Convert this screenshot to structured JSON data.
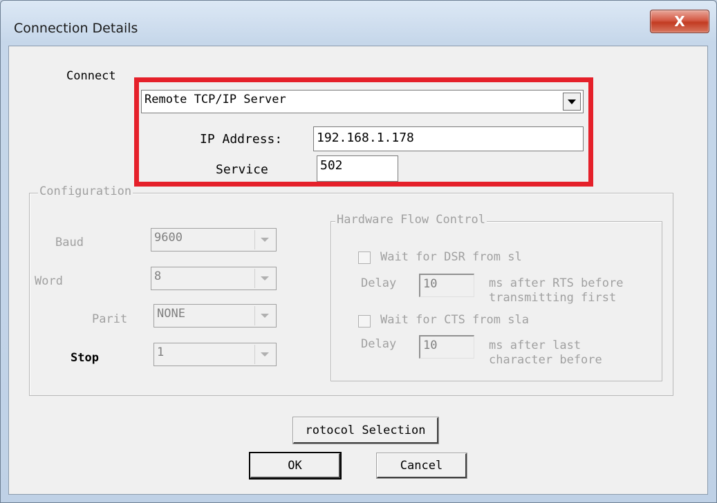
{
  "window": {
    "title": "Connection Details",
    "close_glyph": "X"
  },
  "connect": {
    "label": "Connect",
    "selected": "Remote TCP/IP Server",
    "ip_label": "IP Address:",
    "ip_value": "192.168.1.178",
    "service_label": "Service",
    "service_value": "502"
  },
  "configuration": {
    "title": "Configuration",
    "baud": {
      "label": "Baud",
      "value": "9600"
    },
    "word": {
      "label": "Word",
      "value": "8"
    },
    "parity": {
      "label": "Parit",
      "value": "NONE"
    },
    "stop": {
      "label": "Stop",
      "value": "1"
    }
  },
  "flow": {
    "title": "Hardware Flow Control",
    "dsr": {
      "check_label": "Wait for DSR from sl",
      "delay_label": "Delay",
      "delay_value": "10",
      "note_line1": "ms after RTS before",
      "note_line2": "transmitting first"
    },
    "cts": {
      "check_label": "Wait for CTS from sla",
      "delay_label": "Delay",
      "delay_value": "10",
      "note_line1": "ms after last",
      "note_line2": "character before"
    }
  },
  "buttons": {
    "protocol": "rotocol Selection",
    "ok": "OK",
    "cancel": "Cancel"
  },
  "colors": {
    "highlight": "#e5202a"
  }
}
